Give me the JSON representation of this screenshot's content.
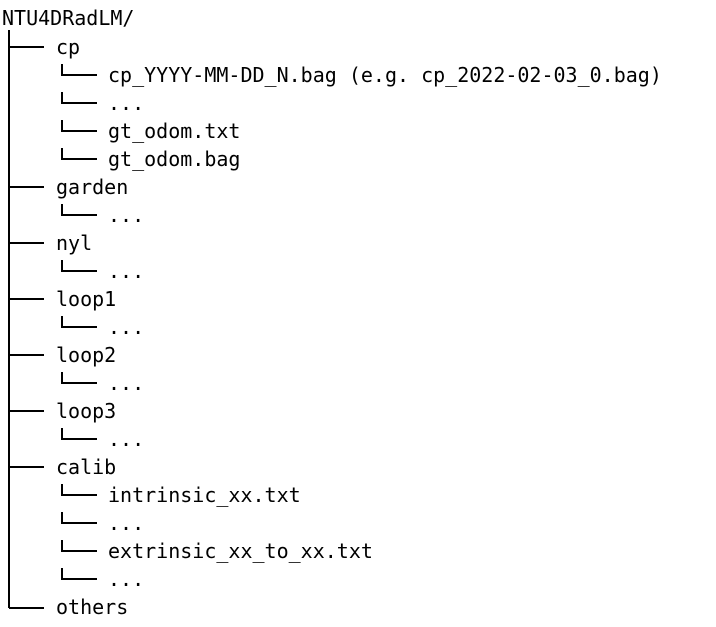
{
  "tree": {
    "root": "NTU4DRadLM/",
    "folders": [
      {
        "name": "cp",
        "children": [
          "cp_YYYY-MM-DD_N.bag (e.g. cp_2022-02-03_0.bag)",
          "...",
          "gt_odom.txt",
          "gt_odom.bag"
        ]
      },
      {
        "name": "garden",
        "children": [
          "..."
        ]
      },
      {
        "name": "nyl",
        "children": [
          "..."
        ]
      },
      {
        "name": "loop1",
        "children": [
          "..."
        ]
      },
      {
        "name": "loop2",
        "children": [
          "..."
        ]
      },
      {
        "name": "loop3",
        "children": [
          "..."
        ]
      },
      {
        "name": "calib",
        "children": [
          "intrinsic_xx.txt",
          "...",
          "extrinsic_xx_to_xx.txt",
          "..."
        ]
      },
      {
        "name": "others",
        "children": []
      }
    ]
  }
}
